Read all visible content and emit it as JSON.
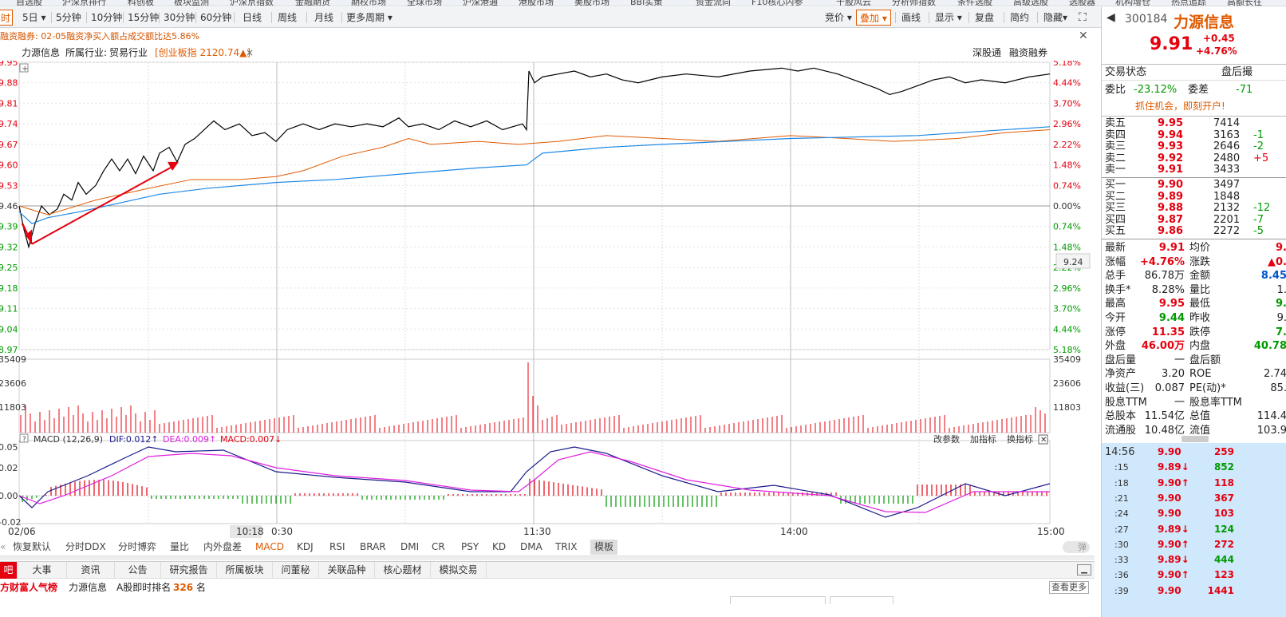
{
  "top_nav": [
    "自选股",
    "沪深京排行",
    "科创板",
    "板块监测",
    "沪深京指数",
    "金融期货",
    "期权市场",
    "全球市场",
    "沪深港通",
    "港股市场",
    "美股市场",
    "BBI实策",
    "资金流向",
    "F10核心内参",
    "千股风云",
    "分析师指数",
    "条件选股",
    "高级选股",
    "选股器",
    "机构增仓",
    "热点追踪",
    "高额长往"
  ],
  "period_bar": {
    "items": [
      "5日",
      "5分钟",
      "10分钟",
      "15分钟",
      "30分钟",
      "60分钟",
      "日线",
      "周线",
      "月线",
      "更多周期"
    ],
    "active_left": "时",
    "right_items": [
      "竞价",
      "叠加",
      "画线",
      "显示",
      "复盘",
      "简约",
      "隐藏"
    ],
    "selected_right": "叠加"
  },
  "notice": "融资融券: 02-05融资净买入额占成交额比达5.86%",
  "stock_header": {
    "name": "力源信息",
    "industry_label": "所属行业:",
    "industry": "贸易行业",
    "board": "[创业板指 2120.74▲]",
    "links": [
      "深股通",
      "融资融券"
    ]
  },
  "price_axis_left": [
    "9.95",
    "9.88",
    "9.81",
    "9.74",
    "9.67",
    "9.60",
    "9.53",
    "9.46",
    "9.39",
    "9.32",
    "9.25",
    "9.18",
    "9.11",
    "9.04",
    "8.97"
  ],
  "price_axis_right_red": [
    "5.18%",
    "4.44%",
    "3.70%",
    "2.96%",
    "2.22%",
    "1.48%",
    "0.74%"
  ],
  "price_axis_right_zero": "0.00%",
  "price_axis_right_green": [
    "0.74%",
    "1.48%",
    "2.22%",
    "2.96%",
    "3.70%",
    "4.44%",
    "5.18%"
  ],
  "hover_price": "9.24",
  "volume_axis_left": [
    "35409",
    "23606",
    "11803"
  ],
  "volume_axis_right": [
    "35409",
    "23606",
    "11803"
  ],
  "macd": {
    "label": "MACD (12,26,9)",
    "dif": "DIF:0.012↑",
    "dea": "DEA:0.009↑",
    "macd": "MACD:0.007↓",
    "tools": [
      "改参数",
      "加指标",
      "换指标"
    ],
    "axis": [
      "0.05",
      "0.02",
      "0.00",
      "-0.02"
    ]
  },
  "time_axis": [
    "02/06",
    "10:18",
    "0:30",
    "11:30",
    "14:00",
    "15:00"
  ],
  "indicator_bar": [
    "恢复默认",
    "分时DDX",
    "分时博弈",
    "量比",
    "内外盘差",
    "MACD",
    "KDJ",
    "RSI",
    "BRAR",
    "DMI",
    "CR",
    "PSY",
    "KD",
    "DMA",
    "TRIX",
    "模板"
  ],
  "indicator_active": "MACD",
  "toggle_label": "弹",
  "bottom_tabs": [
    "吧",
    "大事",
    "资讯",
    "公告",
    "研究报告",
    "所属板块",
    "问董秘",
    "关联品种",
    "核心题材",
    "模拟交易"
  ],
  "rank_row": {
    "prefix": "方财富人气榜",
    "name": "力源信息",
    "rank_label": "A股即时排名",
    "rank": "326",
    "unit": "名",
    "more": "查看更多"
  },
  "quote": {
    "code": "300184",
    "name": "力源信息",
    "price": "9.91",
    "change": "+0.45",
    "change_pct": "+4.76%",
    "status_label": "交易状态",
    "status_value": "盘后撮",
    "weibi_label": "委比",
    "weibi": "-23.12%",
    "weicha_label": "委差",
    "weicha": "-71",
    "promo": "抓住机会，即刻开户!",
    "sells": [
      {
        "label": "卖五",
        "price": "9.95",
        "vol": "7414",
        "chg": ""
      },
      {
        "label": "卖四",
        "price": "9.94",
        "vol": "3163",
        "chg": "-1"
      },
      {
        "label": "卖三",
        "price": "9.93",
        "vol": "2646",
        "chg": "-2"
      },
      {
        "label": "卖二",
        "price": "9.92",
        "vol": "2480",
        "chg": "+5"
      },
      {
        "label": "卖一",
        "price": "9.91",
        "vol": "3433",
        "chg": ""
      }
    ],
    "buys": [
      {
        "label": "买一",
        "price": "9.90",
        "vol": "3497",
        "chg": ""
      },
      {
        "label": "买二",
        "price": "9.89",
        "vol": "1848",
        "chg": ""
      },
      {
        "label": "买三",
        "price": "9.88",
        "vol": "2132",
        "chg": "-12"
      },
      {
        "label": "买四",
        "price": "9.87",
        "vol": "2201",
        "chg": "-7"
      },
      {
        "label": "买五",
        "price": "9.86",
        "vol": "2272",
        "chg": "-5"
      }
    ],
    "stats": [
      {
        "l1": "最新",
        "v1": "9.91",
        "c1": "red",
        "l2": "均价",
        "v2": "9.",
        "c2": "red"
      },
      {
        "l1": "涨幅",
        "v1": "+4.76%",
        "c1": "red",
        "l2": "涨跌",
        "v2": "▲0.",
        "c2": "red"
      },
      {
        "l1": "总手",
        "v1": "86.78万",
        "c1": "",
        "l2": "金额",
        "v2": "8.45",
        "c2": "blue"
      },
      {
        "l1": "换手*",
        "v1": "8.28%",
        "c1": "",
        "l2": "量比",
        "v2": "1.",
        "c2": ""
      },
      {
        "l1": "最高",
        "v1": "9.95",
        "c1": "red",
        "l2": "最低",
        "v2": "9.",
        "c2": "green"
      },
      {
        "l1": "今开",
        "v1": "9.44",
        "c1": "green",
        "l2": "昨收",
        "v2": "9.",
        "c2": ""
      },
      {
        "l1": "涨停",
        "v1": "11.35",
        "c1": "red",
        "l2": "跌停",
        "v2": "7.",
        "c2": "green"
      },
      {
        "l1": "外盘",
        "v1": "46.00万",
        "c1": "red",
        "l2": "内盘",
        "v2": "40.78",
        "c2": "green"
      },
      {
        "l1": "盘后量",
        "v1": "一",
        "c1": "",
        "l2": "盘后额",
        "v2": "",
        "c2": ""
      },
      {
        "l1": "净资产",
        "v1": "3.20",
        "c1": "",
        "l2": "ROE",
        "v2": "2.74",
        "c2": ""
      },
      {
        "l1": "收益(三)",
        "v1": "0.087",
        "c1": "",
        "l2": "PE(动)*",
        "v2": "85.",
        "c2": ""
      },
      {
        "l1": "股息TTM",
        "v1": "一",
        "c1": "",
        "l2": "股息率TTM",
        "v2": "",
        "c2": ""
      },
      {
        "l1": "总股本",
        "v1": "11.54亿",
        "c1": "",
        "l2": "总值",
        "v2": "114.4",
        "c2": ""
      },
      {
        "l1": "流通股",
        "v1": "10.48亿",
        "c1": "",
        "l2": "流值",
        "v2": "103.9",
        "c2": ""
      }
    ],
    "ticks": [
      {
        "t": "14:56",
        "p": "9.90",
        "arrow": "",
        "v": "259",
        "pc": "red",
        "vc": "red"
      },
      {
        "t": ":15",
        "p": "9.89",
        "arrow": "↓",
        "v": "852",
        "pc": "red",
        "vc": "green"
      },
      {
        "t": ":18",
        "p": "9.90",
        "arrow": "↑",
        "v": "118",
        "pc": "red",
        "vc": "red"
      },
      {
        "t": ":21",
        "p": "9.90",
        "arrow": "",
        "v": "367",
        "pc": "red",
        "vc": "red"
      },
      {
        "t": ":24",
        "p": "9.90",
        "arrow": "",
        "v": "103",
        "pc": "red",
        "vc": "red"
      },
      {
        "t": ":27",
        "p": "9.89",
        "arrow": "↓",
        "v": "124",
        "pc": "red",
        "vc": "green"
      },
      {
        "t": ":30",
        "p": "9.90",
        "arrow": "↑",
        "v": "272",
        "pc": "red",
        "vc": "red"
      },
      {
        "t": ":33",
        "p": "9.89",
        "arrow": "↓",
        "v": "444",
        "pc": "red",
        "vc": "green"
      },
      {
        "t": ":36",
        "p": "9.90",
        "arrow": "↑",
        "v": "123",
        "pc": "red",
        "vc": "red"
      },
      {
        "t": ":39",
        "p": "9.90",
        "arrow": "",
        "v": "1441",
        "pc": "red",
        "vc": "red"
      }
    ]
  },
  "colors": {
    "up": "#e4000f",
    "down": "#009900",
    "price_line": "#000000",
    "avg_line": "#e05a00",
    "index_line": "#1e88e5",
    "dif": "#1a1a8c",
    "dea": "#e020e0",
    "accent": "#e05a00"
  }
}
